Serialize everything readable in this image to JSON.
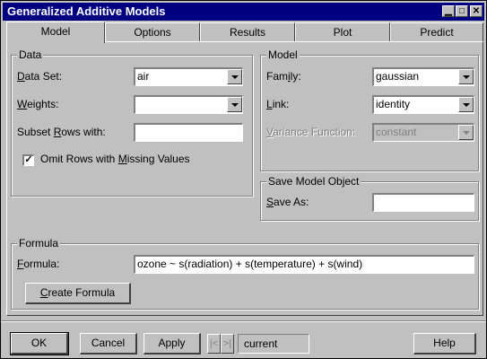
{
  "window": {
    "title": "Generalized Additive Models",
    "controls": [
      "minimize",
      "maximize",
      "close"
    ]
  },
  "tabs": [
    {
      "label": "Model",
      "active": true
    },
    {
      "label": "Options",
      "active": false
    },
    {
      "label": "Results",
      "active": false
    },
    {
      "label": "Plot",
      "active": false
    },
    {
      "label": "Predict",
      "active": false
    }
  ],
  "data_group": {
    "legend": "Data",
    "dataset_label": "Data Set:",
    "dataset_value": "air",
    "weights_label": "Weights:",
    "weights_value": "",
    "subset_label": "Subset Rows with:",
    "subset_value": "",
    "omit_label": "Omit Rows with Missing Values",
    "omit_checked": true
  },
  "model_group": {
    "legend": "Model",
    "family_label": "Family:",
    "family_value": "gaussian",
    "link_label": "Link:",
    "link_value": "identity",
    "variance_label": "Variance Function:",
    "variance_value": "constant",
    "variance_enabled": false
  },
  "save_group": {
    "legend": "Save Model Object",
    "save_label": "Save As:",
    "save_value": ""
  },
  "formula_group": {
    "legend": "Formula",
    "formula_label": "Formula:",
    "formula_value": "ozone ~ s(radiation) + s(temperature) + s(wind)",
    "create_button": "Create Formula"
  },
  "footer": {
    "ok": "OK",
    "cancel": "Cancel",
    "apply": "Apply",
    "nav_prev": "|<",
    "nav_next": ">|",
    "current": "current",
    "help": "Help"
  },
  "colors": {
    "title_bar": "#000080",
    "face": "#c0c0c0"
  }
}
